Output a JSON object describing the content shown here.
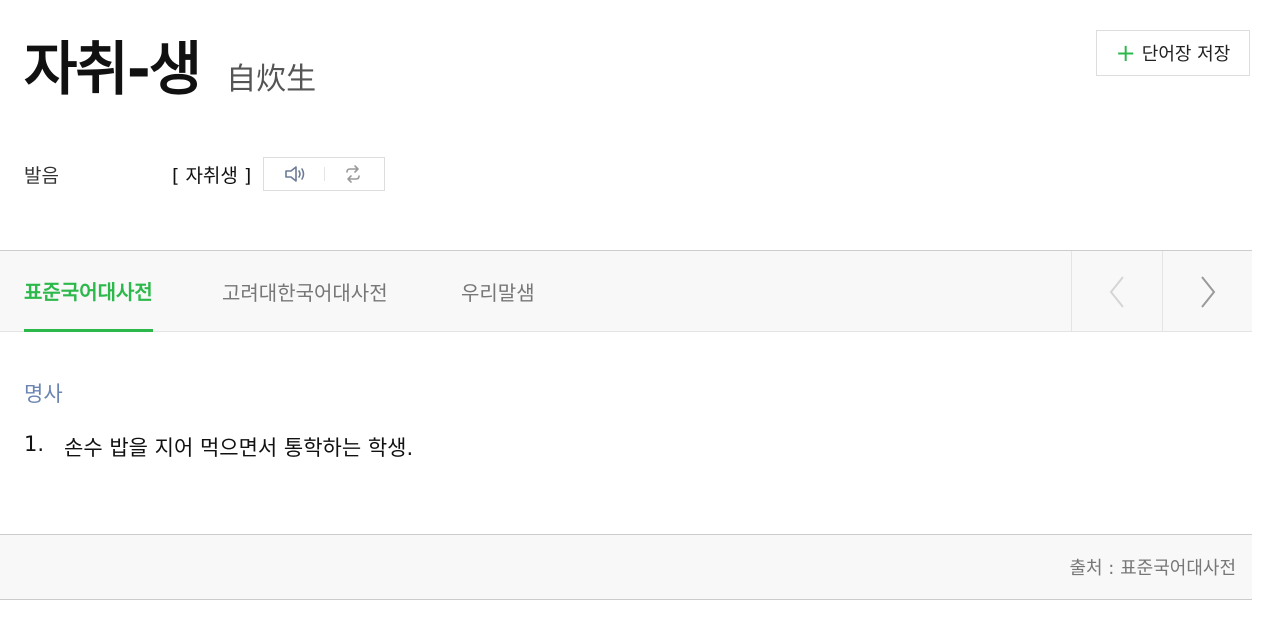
{
  "entry": {
    "word": "자취-생",
    "hanja": "自炊生"
  },
  "actions": {
    "save_label": "단어장 저장"
  },
  "pronunciation": {
    "label": "발음",
    "text": "[ 자취생 ]",
    "icons": [
      "speaker-icon",
      "repeat-icon"
    ]
  },
  "tabs": [
    {
      "label": "표준국어대사전",
      "active": true
    },
    {
      "label": "고려대한국어대사전",
      "active": false
    },
    {
      "label": "우리말샘",
      "active": false
    }
  ],
  "meaning": {
    "part_of_speech": "명사",
    "definitions": [
      {
        "number": "1.",
        "text": "손수 밥을 지어 먹으면서 통학하는 학생."
      }
    ]
  },
  "footer": {
    "source": "출처 : 표준국어대사전"
  },
  "colors": {
    "accent": "#2db84b",
    "pos": "#6b85b2"
  }
}
